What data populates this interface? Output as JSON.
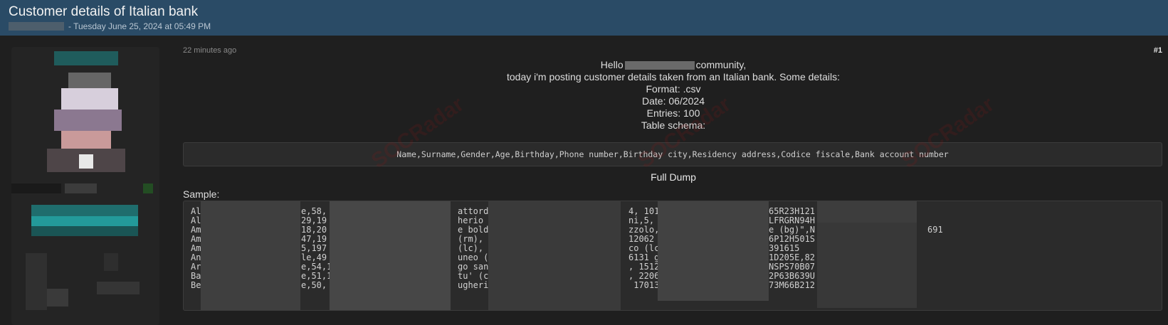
{
  "header": {
    "title": "Customer details of Italian bank",
    "meta": "- Tuesday June 25, 2024 at 05:49 PM"
  },
  "post": {
    "time": "22 minutes ago",
    "number": "#1",
    "greeting_start": "Hello",
    "greeting_end": "community,",
    "lines": [
      "today i'm posting customer details taken from an Italian bank. Some details:",
      "Format: .csv",
      "Date: 06/2024",
      "Entries: 100",
      "Table schema:"
    ],
    "schema": "Name,Surname,Gender,Age,Birthday,Phone number,Birthday city,Residency address,Codice fiscale,Bank account number",
    "full_dump": "Full Dump",
    "sample_label": "Sample:",
    "sample_rows": [
      {
        "a": "Al",
        "b": "e,58,",
        "c": "attord",
        "d": "4, 1014",
        "e": "65R23H121",
        "f": ""
      },
      {
        "a": "Al",
        "b": "29,19",
        "c": "herio",
        "d": "ni,5, 2",
        "e": "LFRGRN94H",
        "f": ""
      },
      {
        "a": "Am",
        "b": "18,20",
        "c": "e bold",
        "d": "zzolo,1",
        "e": "e (bg)\",N",
        "f": "691"
      },
      {
        "a": "Am",
        "b": "47,19",
        "c": "(rm),",
        "d": "12062 c",
        "e": "6P12H501S",
        "f": ""
      },
      {
        "a": "Am",
        "b": "5,197",
        "c": "(lc),",
        "d": "co (lc)",
        "e": "391615",
        "f": ""
      },
      {
        "a": "An",
        "b": "le,49",
        "c": "uneo (",
        "d": "6131 ge",
        "e": "1D205E,82",
        "f": ""
      },
      {
        "a": "Ar",
        "b": "e,54,1",
        "c": "go san",
        "d": ", 15122",
        "e": "NSPS70B07",
        "f": ""
      },
      {
        "a": "Ba",
        "b": "e,51,1",
        "c": "tu' (c",
        "d": ", 22063",
        "e": "2P63B639U",
        "f": ""
      },
      {
        "a": "Be",
        "b": "e,50,",
        "c": "ugheri",
        "d": " 17013",
        "e": "73M66B212",
        "f": ""
      }
    ]
  },
  "watermark": "SOCRadar",
  "colors": {
    "header_bg": "#2a4b66",
    "page_bg": "#1f1f1f",
    "code_bg": "#2b2b2b"
  }
}
